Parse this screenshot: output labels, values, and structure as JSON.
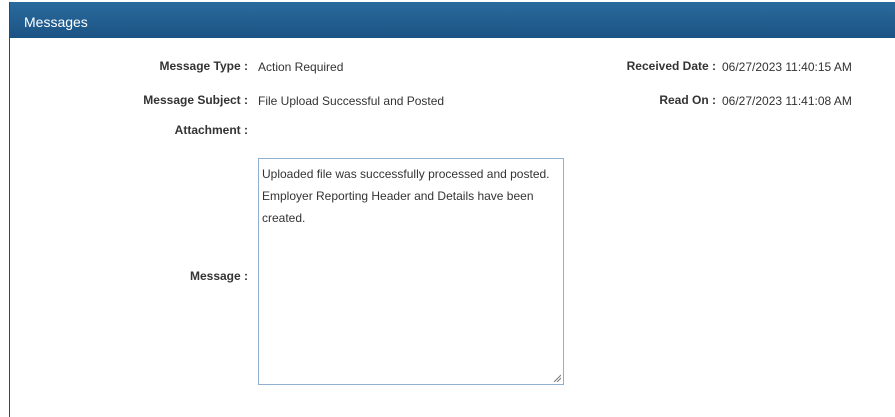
{
  "header": {
    "title": "Messages"
  },
  "fields": {
    "message_type_label": "Message Type :",
    "message_type_value": "Action Required",
    "message_subject_label": "Message Subject :",
    "message_subject_value": "File Upload Successful and Posted",
    "attachment_label": "Attachment :",
    "received_date_label": "Received Date :",
    "received_date_value": "06/27/2023 11:40:15 AM",
    "read_on_label": "Read On :",
    "read_on_value": "06/27/2023 11:41:08 AM",
    "message_label": "Message :"
  },
  "message": {
    "line1": "Uploaded file was successfully processed and posted.",
    "line2": "Employer Reporting Header and Details have been created."
  },
  "colors": {
    "header": "#1b5383",
    "textarea_border": "#8fb1cf"
  },
  "icons": {
    "resize": "resize-grip-icon"
  }
}
